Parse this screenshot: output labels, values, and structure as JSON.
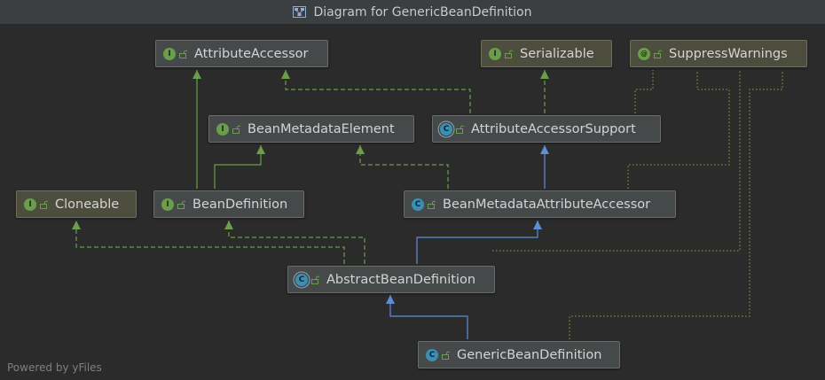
{
  "window": {
    "title": "Diagram for GenericBeanDefinition",
    "footer": "Powered by yFiles"
  },
  "nodes": {
    "attribute_accessor": {
      "label": "AttributeAccessor",
      "kind": "interface",
      "badge": "I"
    },
    "serializable": {
      "label": "Serializable",
      "kind": "interface",
      "badge": "I"
    },
    "suppress_warnings": {
      "label": "SuppressWarnings",
      "kind": "annotation",
      "badge": "@"
    },
    "bean_metadata_element": {
      "label": "BeanMetadataElement",
      "kind": "interface",
      "badge": "I"
    },
    "attribute_accessor_support": {
      "label": "AttributeAccessorSupport",
      "kind": "abstract-class",
      "badge": "C"
    },
    "cloneable": {
      "label": "Cloneable",
      "kind": "interface",
      "badge": "I"
    },
    "bean_definition": {
      "label": "BeanDefinition",
      "kind": "interface",
      "badge": "I"
    },
    "bean_metadata_attribute_accessor": {
      "label": "BeanMetadataAttributeAccessor",
      "kind": "class",
      "badge": "C"
    },
    "abstract_bean_definition": {
      "label": "AbstractBeanDefinition",
      "kind": "abstract-class",
      "badge": "C"
    },
    "generic_bean_definition": {
      "label": "GenericBeanDefinition",
      "kind": "class",
      "badge": "C"
    }
  },
  "edges": [
    {
      "from": "bean_definition",
      "to": "attribute_accessor",
      "type": "extends-interface"
    },
    {
      "from": "bean_definition",
      "to": "bean_metadata_element",
      "type": "extends-interface"
    },
    {
      "from": "attribute_accessor_support",
      "to": "attribute_accessor",
      "type": "implements"
    },
    {
      "from": "attribute_accessor_support",
      "to": "serializable",
      "type": "implements"
    },
    {
      "from": "bean_metadata_attribute_accessor",
      "to": "attribute_accessor_support",
      "type": "extends"
    },
    {
      "from": "bean_metadata_attribute_accessor",
      "to": "bean_metadata_element",
      "type": "implements"
    },
    {
      "from": "abstract_bean_definition",
      "to": "bean_metadata_attribute_accessor",
      "type": "extends"
    },
    {
      "from": "abstract_bean_definition",
      "to": "bean_definition",
      "type": "implements"
    },
    {
      "from": "abstract_bean_definition",
      "to": "cloneable",
      "type": "implements"
    },
    {
      "from": "generic_bean_definition",
      "to": "abstract_bean_definition",
      "type": "extends"
    },
    {
      "from": "attribute_accessor_support",
      "to": "suppress_warnings",
      "type": "annotated"
    },
    {
      "from": "bean_metadata_attribute_accessor",
      "to": "suppress_warnings",
      "type": "annotated"
    },
    {
      "from": "abstract_bean_definition",
      "to": "suppress_warnings",
      "type": "annotated"
    },
    {
      "from": "generic_bean_definition",
      "to": "suppress_warnings",
      "type": "annotated"
    }
  ],
  "colors": {
    "interface_edge": "#6a9e4b",
    "class_edge": "#5e8fd6",
    "annotation_edge": "#8a8a3a",
    "interface_badge": "#6a9e4b",
    "class_badge": "#3c8fb4"
  }
}
